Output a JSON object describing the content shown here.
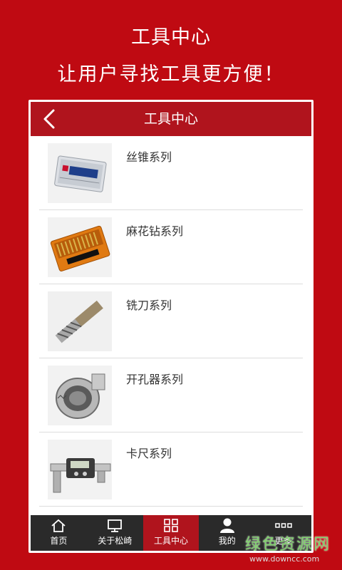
{
  "promo": {
    "title": "工具中心",
    "subtitle": "让用户寻找工具更方便！"
  },
  "header": {
    "title": "工具中心",
    "back_icon": "chevron-left-icon"
  },
  "list": {
    "items": [
      {
        "label": "丝锥系列",
        "image": "tap-set-box"
      },
      {
        "label": "麻花钻系列",
        "image": "twist-drill-set-box"
      },
      {
        "label": "铣刀系列",
        "image": "end-mill"
      },
      {
        "label": "开孔器系列",
        "image": "hole-saw"
      },
      {
        "label": "卡尺系列",
        "image": "digital-caliper"
      }
    ]
  },
  "tabbar": {
    "tabs": [
      {
        "label": "首页",
        "icon": "home-icon",
        "active": false
      },
      {
        "label": "关于松崎",
        "icon": "monitor-icon",
        "active": false
      },
      {
        "label": "工具中心",
        "icon": "grid-icon",
        "active": true
      },
      {
        "label": "我的",
        "icon": "user-icon",
        "active": false
      },
      {
        "label": "更多",
        "icon": "more-icon",
        "active": false
      }
    ]
  },
  "watermark": {
    "name": "绿色资源网",
    "url": "www.downcc.com"
  },
  "colors": {
    "background": "#bf0a12",
    "header": "#b0141d",
    "tabbar": "#2a2a2a",
    "tab_active": "#b0141d"
  }
}
